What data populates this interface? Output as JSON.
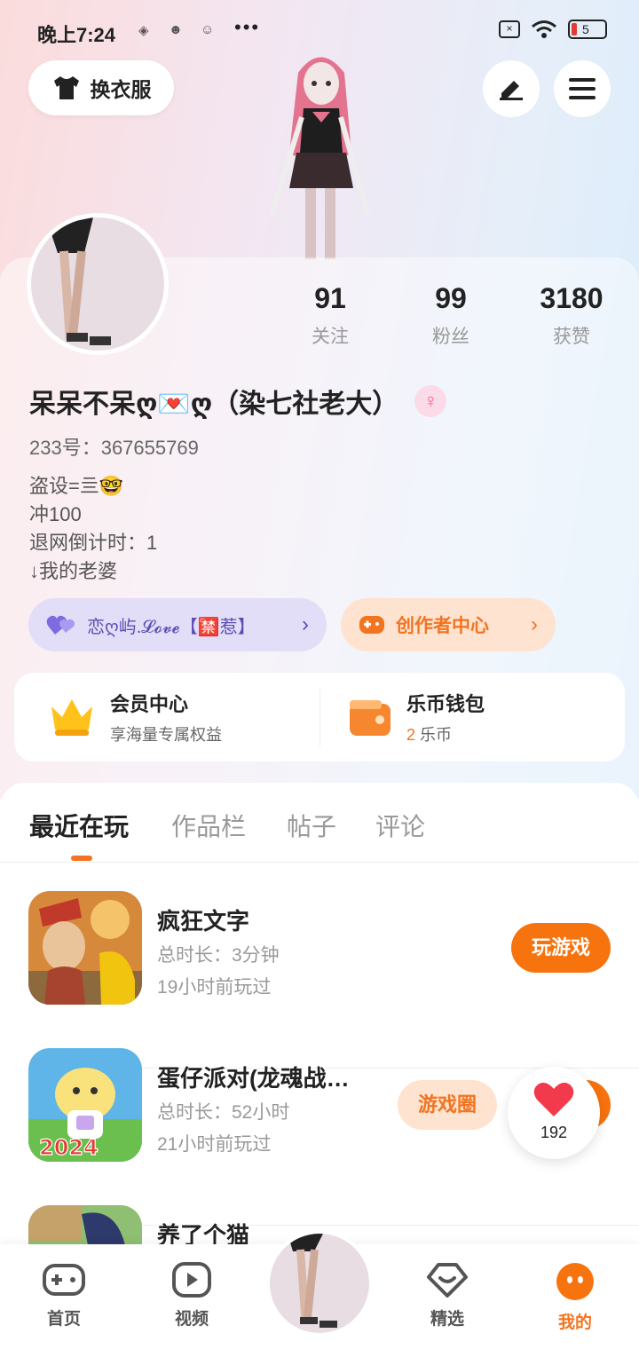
{
  "status_bar": {
    "time": "晚上7:24",
    "dots": "•••",
    "battery": "5"
  },
  "header": {
    "dress_label": "换衣服"
  },
  "stats": [
    {
      "value": "91",
      "label": "关注"
    },
    {
      "value": "99",
      "label": "粉丝"
    },
    {
      "value": "3180",
      "label": "获赞"
    }
  ],
  "profile": {
    "nickname": "呆呆不呆ღ💌ღ（染七社老大）",
    "uid": "233号：367655769",
    "bio_lines": [
      "盗设=亖🤓",
      "冲100",
      "退网倒计时：1",
      "↓我的老婆"
    ]
  },
  "pills": {
    "group_label": "恋ღ屿.𝓛𝓸𝓿𝓮【🈲惹】",
    "creator_label": "创作者中心"
  },
  "benefits": {
    "vip_title": "会员中心",
    "vip_sub": "享海量专属权益",
    "wallet_title": "乐币钱包",
    "wallet_amount": "2",
    "wallet_unit": "乐币"
  },
  "tabs": [
    "最近在玩",
    "作品栏",
    "帖子",
    "评论"
  ],
  "games": [
    {
      "title": "疯狂文字",
      "duration": "总时长：3分钟",
      "last_played": "19小时前玩过",
      "play_label": "玩游戏"
    },
    {
      "title": "蛋仔派对(龙魂战…",
      "duration": "总时长：52小时",
      "last_played": "21小时前玩过",
      "circle_label": "游戏圈",
      "badge": "2024"
    },
    {
      "title": "养了个猫"
    }
  ],
  "floating": {
    "likes": "192"
  },
  "nav": [
    {
      "label": "首页"
    },
    {
      "label": "视频"
    },
    {
      "label": "精选"
    },
    {
      "label": "我的"
    }
  ],
  "colors": {
    "accent": "#f7730e",
    "purple": "#5a4fb3"
  }
}
